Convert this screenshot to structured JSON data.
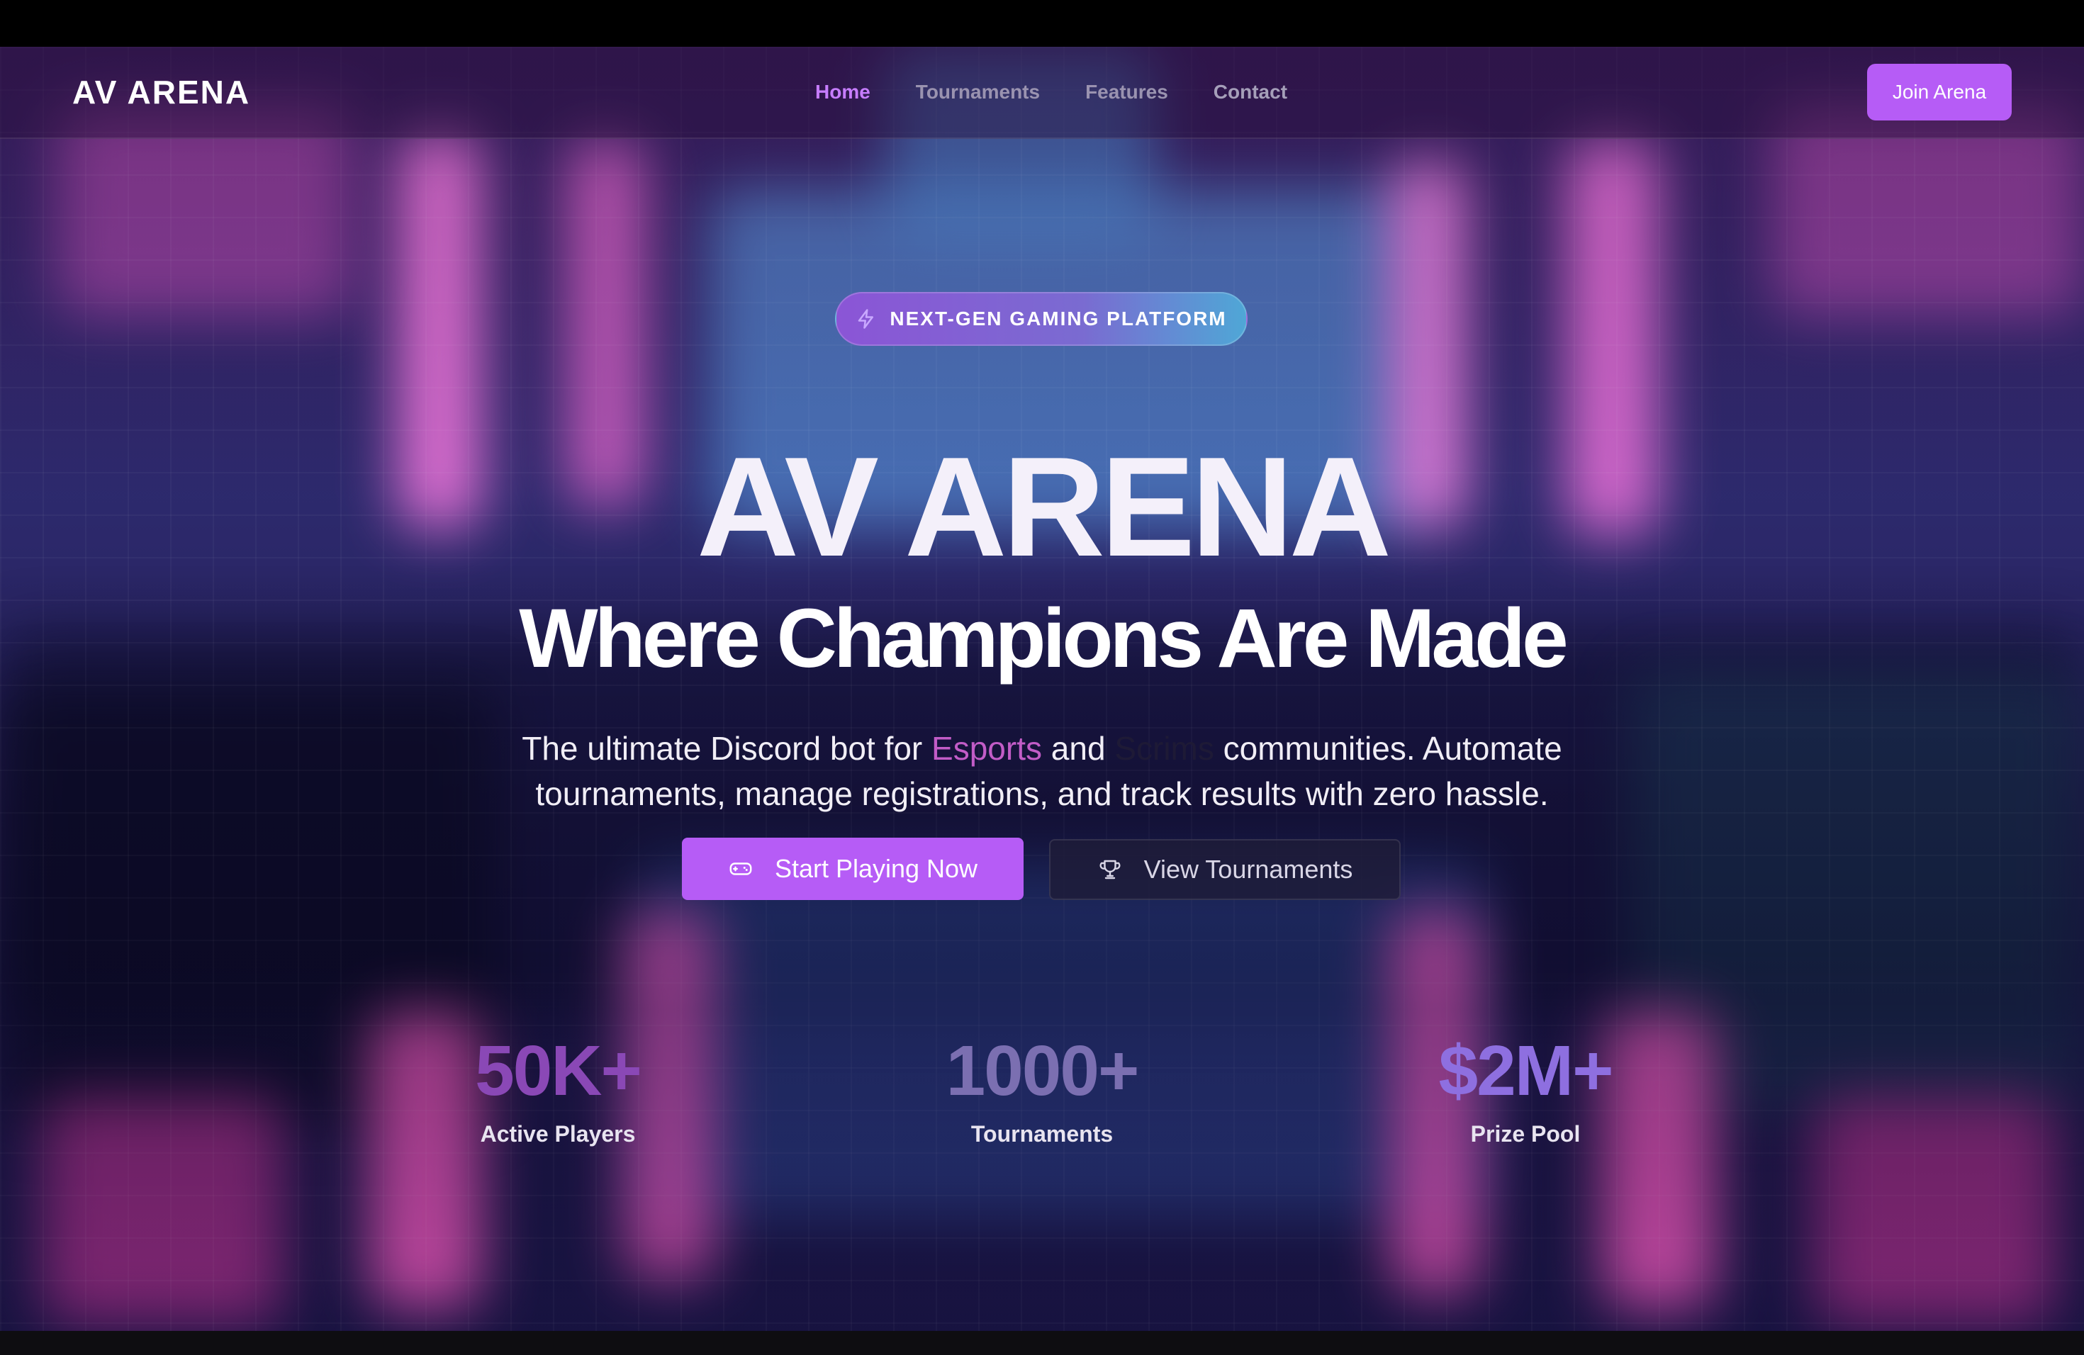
{
  "nav": {
    "logo": "AV ARENA",
    "links": [
      "Home",
      "Tournaments",
      "Features",
      "Contact"
    ],
    "cta": "Join Arena"
  },
  "hero": {
    "badge": "NEXT-GEN GAMING PLATFORM",
    "title": "AV ARENA",
    "subtitle": "Where Champions Are Made",
    "desc_part1": "The ultimate Discord bot for ",
    "desc_highlight1": "Esports",
    "desc_part2": " and ",
    "desc_highlight2": "Scrims",
    "desc_part3": " communities. Automate tournaments, manage registrations, and track results with zero hassle."
  },
  "buttons": {
    "primary": "Start Playing Now",
    "secondary": "View Tournaments"
  },
  "stats": [
    {
      "value": "50K+",
      "label": "Active Players"
    },
    {
      "value": "1000+",
      "label": "Tournaments"
    },
    {
      "value": "$2M+",
      "label": "Prize Pool"
    }
  ],
  "colors": {
    "accent": "#b65cf6",
    "nav_active": "#c77dff",
    "esports_highlight": "#c25cc7"
  }
}
